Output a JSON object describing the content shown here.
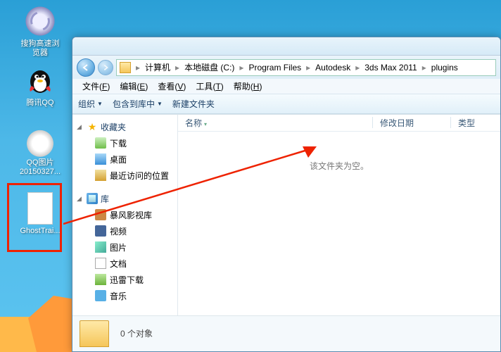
{
  "desktop": {
    "icons": [
      {
        "label": "搜狗高速浏\n览器"
      },
      {
        "label": "腾讯QQ"
      },
      {
        "label": "QQ图片\n20150327..."
      },
      {
        "label": "GhostTrai..."
      }
    ]
  },
  "explorer": {
    "breadcrumbs": [
      "计算机",
      "本地磁盘 (C:)",
      "Program Files",
      "Autodesk",
      "3ds Max 2011",
      "plugins"
    ],
    "menu": [
      {
        "label": "文件",
        "key": "F"
      },
      {
        "label": "编辑",
        "key": "E"
      },
      {
        "label": "查看",
        "key": "V"
      },
      {
        "label": "工具",
        "key": "T"
      },
      {
        "label": "帮助",
        "key": "H"
      }
    ],
    "toolbar": {
      "organize": "组织",
      "include": "包含到库中",
      "newfolder": "新建文件夹"
    },
    "nav": {
      "favorites": {
        "label": "收藏夹",
        "items": [
          "下载",
          "桌面",
          "最近访问的位置"
        ]
      },
      "libraries": {
        "label": "库",
        "items": [
          "暴风影视库",
          "视频",
          "图片",
          "文档",
          "迅雷下载",
          "音乐"
        ]
      }
    },
    "columns": {
      "name": "名称",
      "modified": "修改日期",
      "type": "类型"
    },
    "empty": "该文件夹为空。",
    "status": "0 个对象"
  }
}
